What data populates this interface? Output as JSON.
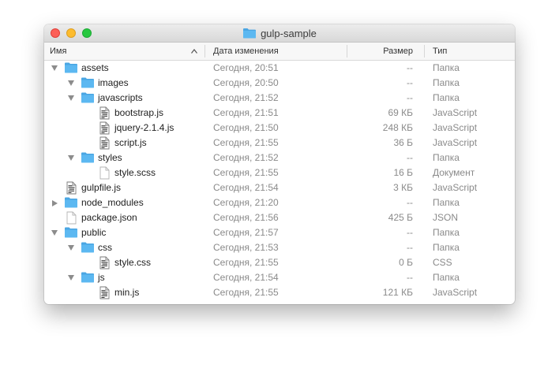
{
  "window": {
    "title": "gulp-sample"
  },
  "columns": {
    "name": "Имя",
    "date": "Дата изменения",
    "size": "Размер",
    "kind": "Тип"
  },
  "rows": [
    {
      "name": "assets",
      "date": "Сегодня, 20:51",
      "size": "--",
      "kind": "Папка",
      "icon": "folder-icon",
      "level": 0,
      "disclosure": "open"
    },
    {
      "name": "images",
      "date": "Сегодня, 20:50",
      "size": "--",
      "kind": "Папка",
      "icon": "folder-icon",
      "level": 1,
      "disclosure": "open"
    },
    {
      "name": "javascripts",
      "date": "Сегодня, 21:52",
      "size": "--",
      "kind": "Папка",
      "icon": "folder-icon",
      "level": 1,
      "disclosure": "open"
    },
    {
      "name": "bootstrap.js",
      "date": "Сегодня, 21:51",
      "size": "69 КБ",
      "kind": "JavaScript",
      "icon": "script-file-icon",
      "level": 2,
      "disclosure": "none"
    },
    {
      "name": "jquery-2.1.4.js",
      "date": "Сегодня, 21:50",
      "size": "248 КБ",
      "kind": "JavaScript",
      "icon": "script-file-icon",
      "level": 2,
      "disclosure": "none"
    },
    {
      "name": "script.js",
      "date": "Сегодня, 21:55",
      "size": "36 Б",
      "kind": "JavaScript",
      "icon": "script-file-icon",
      "level": 2,
      "disclosure": "none"
    },
    {
      "name": "styles",
      "date": "Сегодня, 21:52",
      "size": "--",
      "kind": "Папка",
      "icon": "folder-icon",
      "level": 1,
      "disclosure": "open"
    },
    {
      "name": "style.scss",
      "date": "Сегодня, 21:55",
      "size": "16 Б",
      "kind": "Документ",
      "icon": "document-icon",
      "level": 2,
      "disclosure": "none"
    },
    {
      "name": "gulpfile.js",
      "date": "Сегодня, 21:54",
      "size": "3 КБ",
      "kind": "JavaScript",
      "icon": "script-file-icon",
      "level": 0,
      "disclosure": "none"
    },
    {
      "name": "node_modules",
      "date": "Сегодня, 21:20",
      "size": "--",
      "kind": "Папка",
      "icon": "folder-icon",
      "level": 0,
      "disclosure": "closed"
    },
    {
      "name": "package.json",
      "date": "Сегодня, 21:56",
      "size": "425 Б",
      "kind": "JSON",
      "icon": "document-icon",
      "level": 0,
      "disclosure": "none"
    },
    {
      "name": "public",
      "date": "Сегодня, 21:57",
      "size": "--",
      "kind": "Папка",
      "icon": "folder-icon",
      "level": 0,
      "disclosure": "open"
    },
    {
      "name": "css",
      "date": "Сегодня, 21:53",
      "size": "--",
      "kind": "Папка",
      "icon": "folder-icon",
      "level": 1,
      "disclosure": "open"
    },
    {
      "name": "style.css",
      "date": "Сегодня, 21:55",
      "size": "0 Б",
      "kind": "CSS",
      "icon": "script-file-icon",
      "level": 2,
      "disclosure": "none"
    },
    {
      "name": "js",
      "date": "Сегодня, 21:54",
      "size": "--",
      "kind": "Папка",
      "icon": "folder-icon",
      "level": 1,
      "disclosure": "open"
    },
    {
      "name": "min.js",
      "date": "Сегодня, 21:55",
      "size": "121 КБ",
      "kind": "JavaScript",
      "icon": "script-file-icon",
      "level": 2,
      "disclosure": "none"
    }
  ],
  "colors": {
    "folder": "#5cb8f1",
    "folder_tab": "#4aa6e3",
    "secondary_text": "#8a8a8a"
  }
}
